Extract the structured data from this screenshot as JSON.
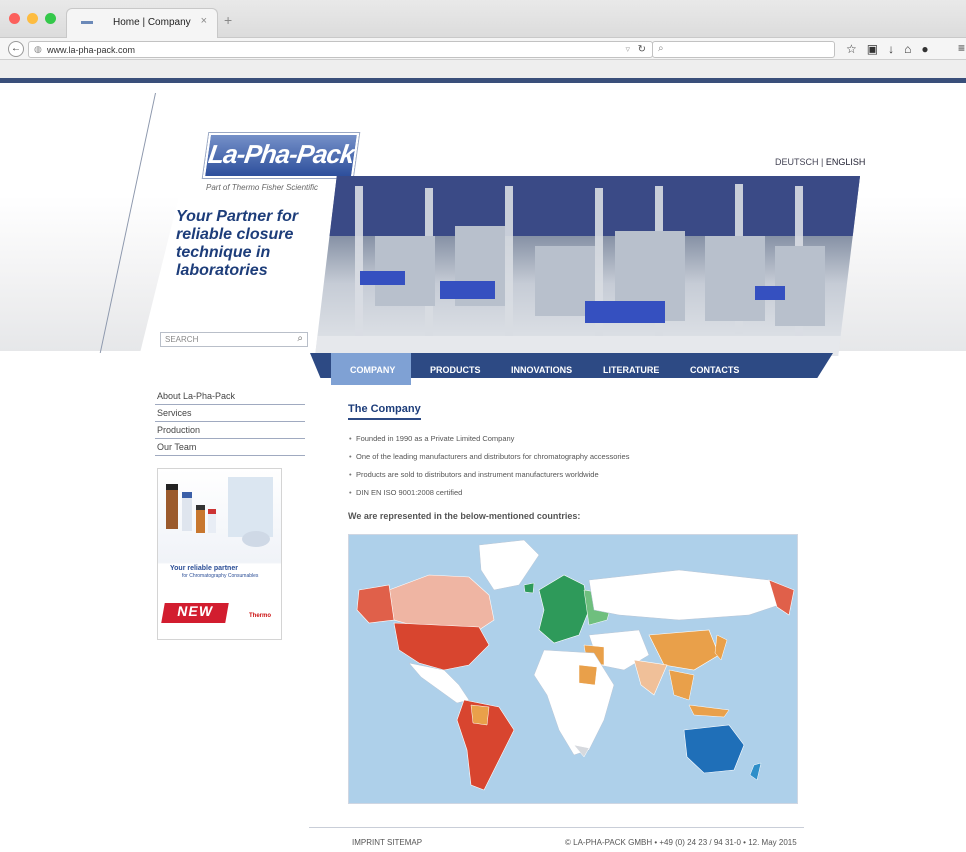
{
  "browser": {
    "tab_title": "Home | Company",
    "tab_close": "×",
    "new_tab": "+",
    "url": "www.la-pha-pack.com",
    "search_placeholder": ""
  },
  "header": {
    "logo_text": "La-Pha-Pack",
    "logo_sub": "Part of Thermo Fisher Scientific",
    "tagline": "Your Partner for reliable closure technique in laboratories",
    "search_placeholder": "SEARCH",
    "lang_de": "DEUTSCH",
    "lang_sep": "|",
    "lang_en": "ENGLISH"
  },
  "nav": {
    "items": [
      "COMPANY",
      "PRODUCTS",
      "INNOVATIONS",
      "LITERATURE",
      "CONTACTS"
    ],
    "active": "COMPANY"
  },
  "sidebar": {
    "items": [
      "About La-Pha-Pack",
      "Services",
      "Production",
      "Our Team"
    ]
  },
  "ad": {
    "line1": "Your reliable partner",
    "line2": "for Chromatography Consumables",
    "badge": "NEW",
    "brand": "Thermo"
  },
  "content": {
    "title": "The Company",
    "bullets": [
      "Founded in 1990 as a Private Limited Company",
      "One of the leading manufacturers and distributors for chromatography accessories",
      "Products are sold to distributors and instrument manufacturers worldwide",
      "DIN EN ISO 9001:2008 certified"
    ],
    "represented": "We are represented in the below-mentioned countries:"
  },
  "footer": {
    "links": "IMPRINT  SITEMAP",
    "company": "© LA-PHA-PACK GMBH • +49 (0) 24 23 / 94 31-0 • 12. May 2015"
  },
  "colors": {
    "brand_blue": "#2d4a84",
    "active_tab": "#7fa1d4",
    "map_ocean": "#aed0ea",
    "map_red": "#e0604a",
    "map_orange": "#e9a04a",
    "map_green": "#2e9a5a",
    "map_blue": "#1f6fb8"
  },
  "icons": [
    "back-icon",
    "globe-icon",
    "reload-icon",
    "search-icon",
    "star-icon",
    "bookmark-icon",
    "download-icon",
    "home-icon",
    "chat-icon",
    "menu-icon"
  ]
}
